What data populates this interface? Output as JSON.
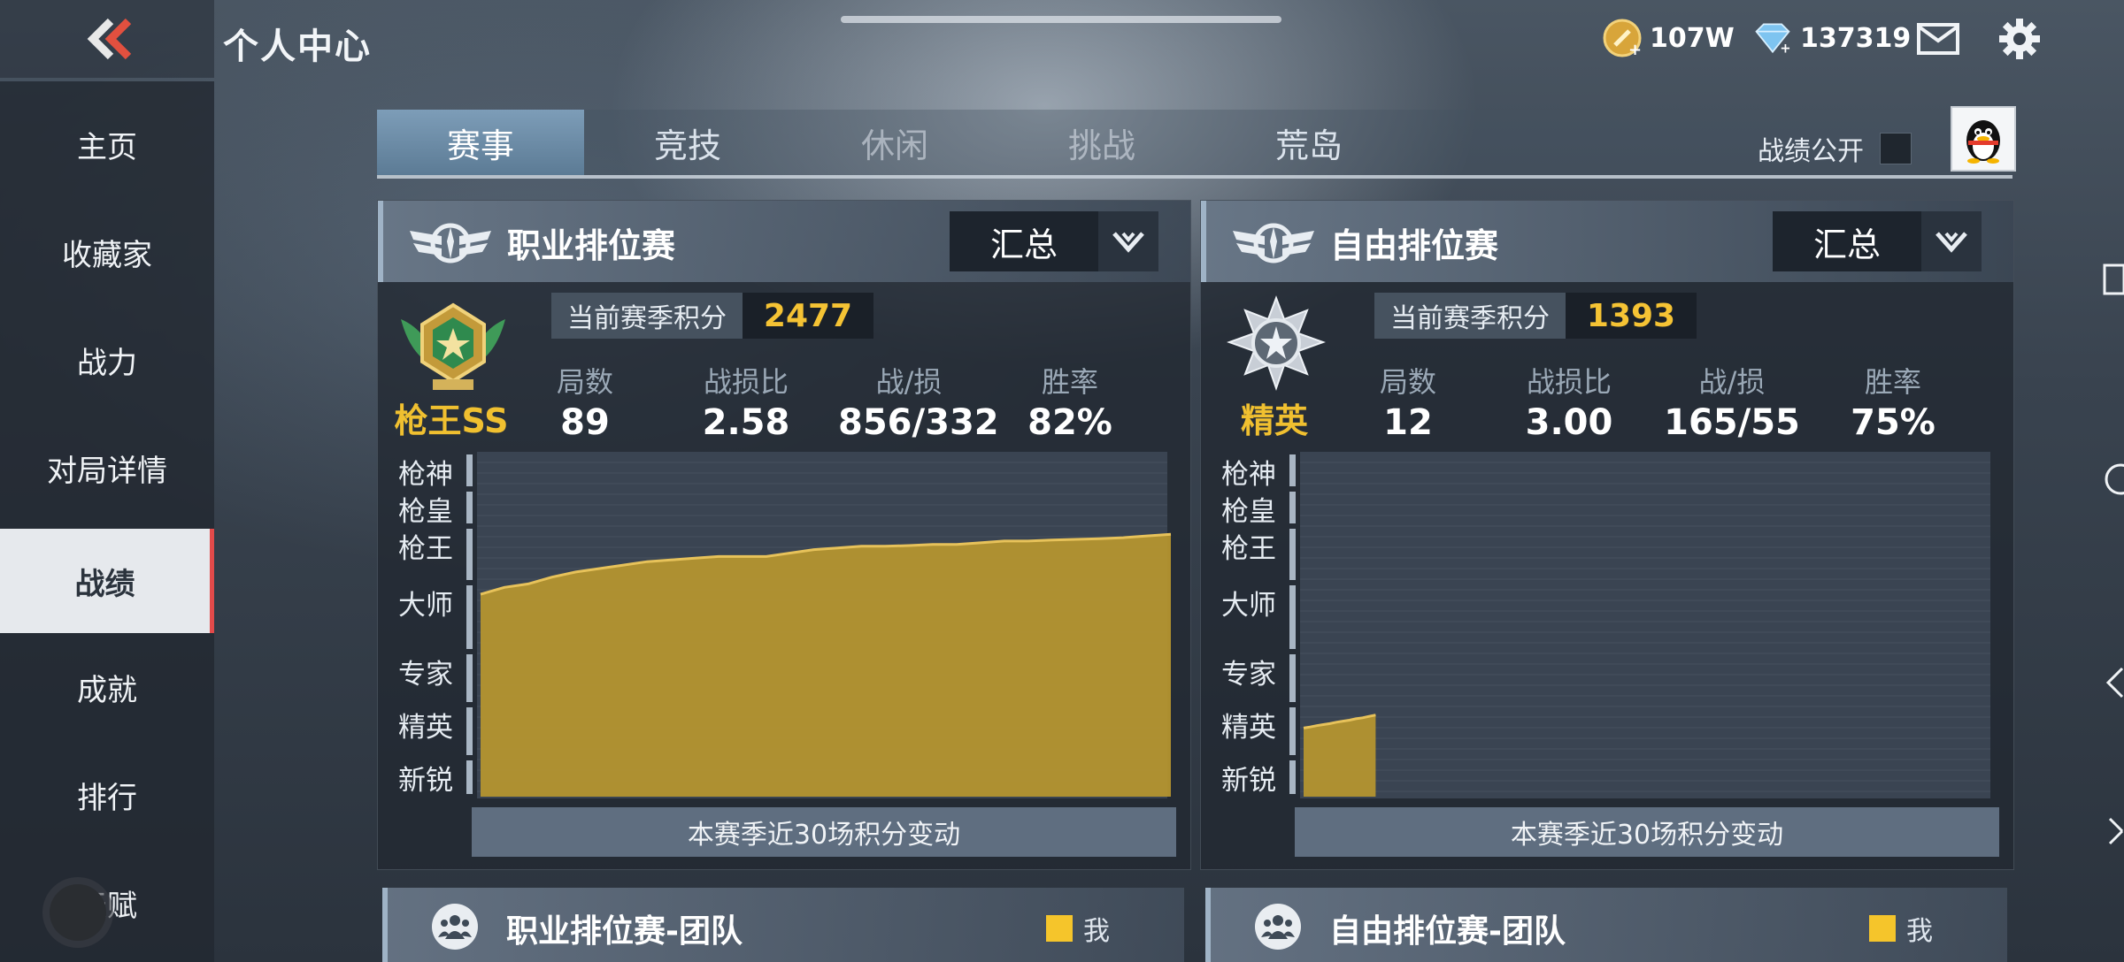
{
  "header": {
    "title": "个人中心",
    "gold": "107W",
    "diamonds": "137319",
    "icons": [
      "back-chevrons-icon",
      "gold-coin-icon",
      "diamond-icon",
      "mail-icon",
      "gear-icon"
    ]
  },
  "sidebar": {
    "items": [
      {
        "label": "主页"
      },
      {
        "label": "收藏家"
      },
      {
        "label": "战力"
      },
      {
        "label": "对局详情"
      },
      {
        "label": "战绩",
        "active": true
      },
      {
        "label": "成就"
      },
      {
        "label": "排行"
      },
      {
        "label": "天赋"
      }
    ]
  },
  "tabs": [
    {
      "label": "赛事",
      "active": true
    },
    {
      "label": "竞技"
    },
    {
      "label": "休闲"
    },
    {
      "label": "挑战"
    },
    {
      "label": "荒岛"
    }
  ],
  "public_toggle": {
    "label": "战绩公开",
    "checked": false
  },
  "colors": {
    "accent": "#f5c334",
    "chart_fill": "#b8972f",
    "active_marker": "#e24a4a"
  },
  "panels": [
    {
      "title": "职业排位赛",
      "dropdown": "汇总",
      "rank_name": "枪王SS",
      "season_label": "当前赛季积分",
      "season_score": "2477",
      "stats": [
        {
          "k": "局数",
          "v": "89"
        },
        {
          "k": "战损比",
          "v": "2.58"
        },
        {
          "k": "战/损",
          "v": "856/332"
        },
        {
          "k": "胜率",
          "v": "82%"
        }
      ],
      "footer": "本赛季近30场积分变动"
    },
    {
      "title": "自由排位赛",
      "dropdown": "汇总",
      "rank_name": "精英",
      "season_label": "当前赛季积分",
      "season_score": "1393",
      "stats": [
        {
          "k": "局数",
          "v": "12"
        },
        {
          "k": "战损比",
          "v": "3.00"
        },
        {
          "k": "战/损",
          "v": "165/55"
        },
        {
          "k": "胜率",
          "v": "75%"
        }
      ],
      "footer": "本赛季近30场积分变动"
    }
  ],
  "chart_data": [
    {
      "type": "area",
      "y_tier_labels": [
        "枪神",
        "枪皇",
        "枪王",
        "大师",
        "专家",
        "精英",
        "新锐"
      ],
      "x": [
        1,
        2,
        3,
        4,
        5,
        6,
        7,
        8,
        9,
        10,
        11,
        12,
        13,
        14,
        15,
        16,
        17,
        18,
        19,
        20,
        21,
        22,
        23,
        24,
        25,
        26,
        27,
        28,
        29,
        30
      ],
      "values": [
        0.59,
        0.61,
        0.62,
        0.64,
        0.655,
        0.665,
        0.675,
        0.685,
        0.69,
        0.695,
        0.7,
        0.7,
        0.7,
        0.71,
        0.72,
        0.725,
        0.73,
        0.73,
        0.732,
        0.735,
        0.735,
        0.74,
        0.745,
        0.745,
        0.748,
        0.75,
        0.752,
        0.755,
        0.76,
        0.765
      ]
    },
    {
      "type": "area",
      "y_tier_labels": [
        "枪神",
        "枪皇",
        "枪王",
        "大师",
        "专家",
        "精英",
        "新锐"
      ],
      "x": [
        1,
        2,
        3,
        4,
        5,
        6,
        7,
        8,
        9,
        10,
        11,
        12
      ],
      "values": [
        0.2,
        0.203,
        0.207,
        0.21,
        0.213,
        0.217,
        0.22,
        0.223,
        0.227,
        0.23,
        0.234,
        0.238
      ]
    }
  ],
  "bottom_panels": [
    {
      "title": "职业排位赛-团队",
      "legend": "我"
    },
    {
      "title": "自由排位赛-团队",
      "legend": "我"
    }
  ]
}
